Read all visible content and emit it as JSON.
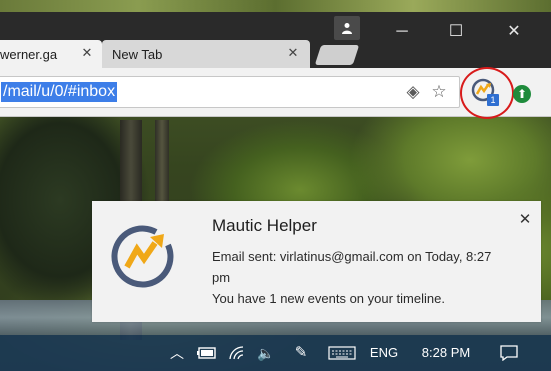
{
  "browser": {
    "tabs": [
      {
        "label": "werner.ga",
        "active": true
      },
      {
        "label": "New Tab",
        "active": false
      }
    ],
    "window_controls": {
      "minimize": "─",
      "maximize": "☐",
      "close": "✕"
    },
    "address_bar": {
      "url": "/mail/u/0/#inbox"
    },
    "extension": {
      "name": "Mautic Helper",
      "badge": "1"
    },
    "colors": {
      "selection": "#3d7ee8",
      "highlight_ring": "#d81b1b",
      "badge": "#2f6fd1"
    }
  },
  "notification": {
    "title": "Mautic Helper",
    "line1": "Email sent: virlatinus@gmail.com on Today, 8:27 pm",
    "line2": "You have 1 new events on your timeline.",
    "close": "✕"
  },
  "taskbar": {
    "language": "ENG",
    "time": "8:28 PM"
  }
}
